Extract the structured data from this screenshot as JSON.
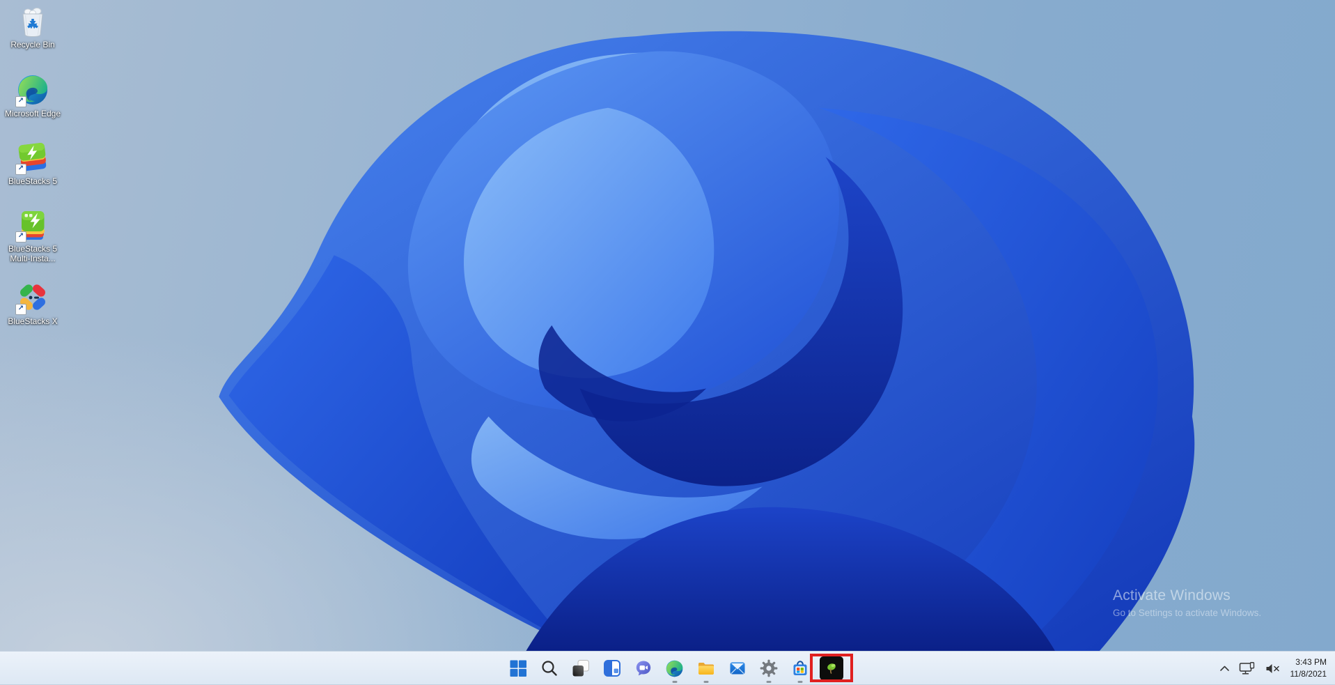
{
  "wallpaper": {
    "theme": "windows-11-bloom",
    "bg_color_top_left": "#a9bdd3",
    "bg_color_right": "#83a9cd",
    "bloom_primary": "#2e6be4",
    "bloom_dark": "#0c2390",
    "bloom_light": "#7db4f6"
  },
  "desktop": {
    "icons": [
      {
        "label": "Recycle Bin",
        "shortcut": false
      },
      {
        "label": "Microsoft Edge",
        "shortcut": true
      },
      {
        "label": "BlueStacks 5",
        "shortcut": true
      },
      {
        "label": "BlueStacks 5 Multi-Insta...",
        "shortcut": true
      },
      {
        "label": "BlueStacks X",
        "shortcut": true
      }
    ],
    "shortcut_arrow_glyph": "↗"
  },
  "watermark": {
    "title": "Activate Windows",
    "subtitle": "Go to Settings to activate Windows."
  },
  "taskbar": {
    "items": [
      {
        "name": "start",
        "indicator": false,
        "highlighted": false
      },
      {
        "name": "search",
        "indicator": false,
        "highlighted": false
      },
      {
        "name": "task-view",
        "indicator": false,
        "highlighted": false
      },
      {
        "name": "widgets",
        "indicator": false,
        "highlighted": false
      },
      {
        "name": "chat",
        "indicator": false,
        "highlighted": false
      },
      {
        "name": "edge",
        "indicator": true,
        "highlighted": false
      },
      {
        "name": "file-explorer",
        "indicator": true,
        "highlighted": false
      },
      {
        "name": "mail",
        "indicator": false,
        "highlighted": false
      },
      {
        "name": "settings",
        "indicator": true,
        "highlighted": false
      },
      {
        "name": "store",
        "indicator": true,
        "highlighted": false
      },
      {
        "name": "bluestacks-app",
        "indicator": false,
        "highlighted": true
      }
    ],
    "annotation": {
      "shape": "rectangle",
      "color": "#e02020",
      "purpose": "highlights pinned BlueStacks app icon"
    },
    "indicator_color": "#8d949c",
    "tray": {
      "hidden_icons_chevron": "^",
      "network_icon": "ethernet-no-internet",
      "volume_icon": "muted",
      "time": "3:43 PM",
      "date": "11/8/2021"
    }
  }
}
